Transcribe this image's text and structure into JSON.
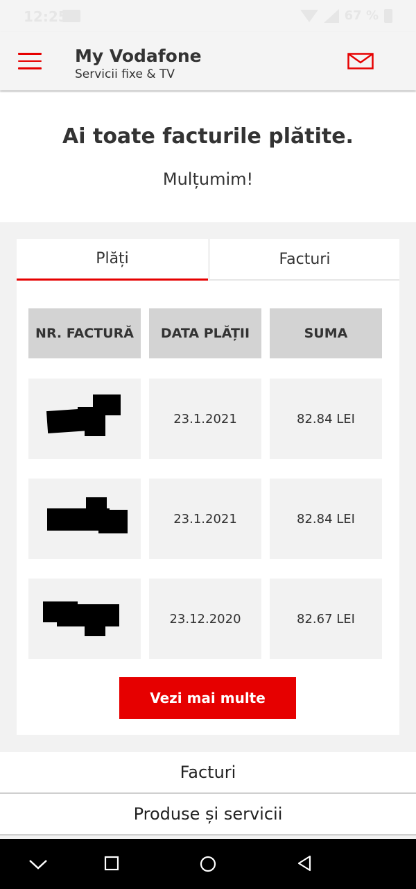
{
  "status_bar": {
    "time": "12:25",
    "battery": "67 %"
  },
  "header": {
    "title": "My Vodafone",
    "subtitle": "Servicii fixe & TV"
  },
  "hero": {
    "title": "Ai toate facturile plătite.",
    "subtitle": "Mulțumim!"
  },
  "tabs": [
    {
      "label": "Plăți",
      "active": true
    },
    {
      "label": "Facturi",
      "active": false
    }
  ],
  "table": {
    "headers": [
      "NR. FACTURĂ",
      "DATA PLĂȚII",
      "SUMA"
    ],
    "rows": [
      {
        "date": "23.1.2021",
        "amount": "82.84 LEI"
      },
      {
        "date": "23.1.2021",
        "amount": "82.84 LEI"
      },
      {
        "date": "23.12.2020",
        "amount": "82.67 LEI"
      }
    ]
  },
  "more_button": "Vezi mai multe",
  "links": [
    "Facturi",
    "Produse și servicii"
  ],
  "colors": {
    "accent": "#e60000",
    "background": "#f2f2f2"
  }
}
